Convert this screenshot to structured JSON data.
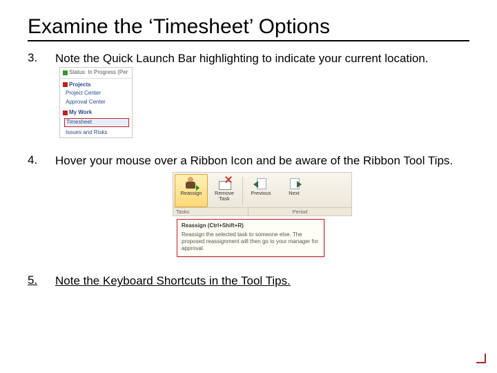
{
  "title": "Examine the ‘Timesheet’ Options",
  "steps": [
    {
      "num": "3.",
      "text": "Note the Quick Launch Bar highlighting to indicate your current location."
    },
    {
      "num": "4.",
      "text": "Hover your mouse over a Ribbon Icon and be aware of the Ribbon Tool Tips."
    },
    {
      "num": "5.",
      "text": "Note the Keyboard Shortcuts in the Tool Tips."
    }
  ],
  "quicklaunch": {
    "status_line": "Status: In Progress (Per",
    "sections": [
      {
        "name": "Projects",
        "items": [
          "Project Center",
          "Approval Center"
        ]
      },
      {
        "name": "My Work",
        "items": [],
        "selected": "Timesheet",
        "after": [
          "Issues and Risks"
        ]
      }
    ]
  },
  "ribbon": {
    "buttons": [
      {
        "label": "Reassign",
        "icon": "person-reassign-icon",
        "selected": true
      },
      {
        "label": "Remove Task",
        "icon": "remove-task-icon"
      },
      {
        "label": "Previous",
        "icon": "previous-icon"
      },
      {
        "label": "Next",
        "icon": "next-icon"
      }
    ],
    "groups": [
      "Tasks",
      "Period"
    ],
    "tooltip": {
      "title": "Reassign (Ctrl+Shift+R)",
      "body": "Reassign the selected task to someone else. The proposed reassignment will then go to your manager for approval."
    }
  }
}
